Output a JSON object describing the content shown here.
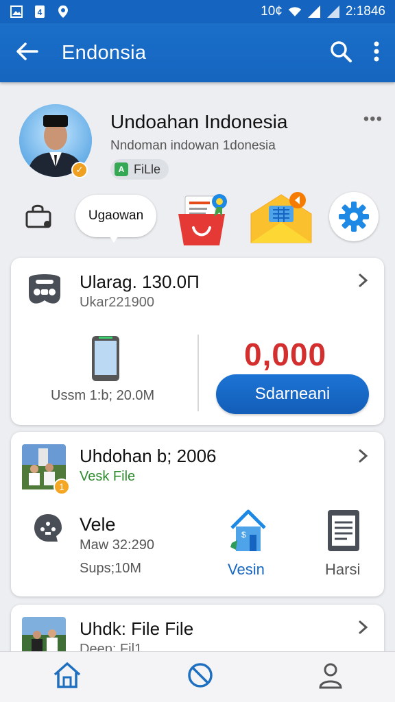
{
  "status_bar": {
    "left_icons": [
      "image-icon",
      "sim-4-icon",
      "location-icon"
    ],
    "right_text": "10¢",
    "clock": "2:1846"
  },
  "app_bar": {
    "title": "Endonsia",
    "icons": [
      "back-arrow-icon",
      "search-icon",
      "more-vertical-icon"
    ]
  },
  "profile": {
    "name": "Undoahan Indonesia",
    "subtitle": "Nndoman  indowan 1donesia",
    "chip_label": "FiLle",
    "more_label": "•••"
  },
  "quick_actions": {
    "bubble_label": "Ugaowan",
    "icons": [
      "bag-lock-icon",
      "shopping-basket-icon",
      "mail-grid-icon",
      "gear-icon"
    ]
  },
  "card1": {
    "title": "Ularag. 130.0П",
    "subtitle": "Ukar221900",
    "device_caption": "Ussm 1:b; 20.0M",
    "price": "0,000",
    "button_label": "Sdarneani"
  },
  "card2": {
    "title": "Uhdohan b; 2006",
    "subtitle": "Vesk File",
    "badge": "1",
    "item_title": "Vele",
    "item_line1": "Maw 32:290",
    "item_line2": "Sups;10M",
    "action1_label": "Vesin",
    "action2_label": "Harsi"
  },
  "card3": {
    "title": "Uhdk: File File",
    "subtitle": "Deep: Fil1"
  },
  "bottom_nav": {
    "items": [
      "home-icon",
      "block-icon",
      "person-icon"
    ]
  },
  "colors": {
    "primary": "#1565c0",
    "price_red": "#d32f2f",
    "green_text": "#2e8b2e",
    "link_blue": "#1666c0"
  }
}
